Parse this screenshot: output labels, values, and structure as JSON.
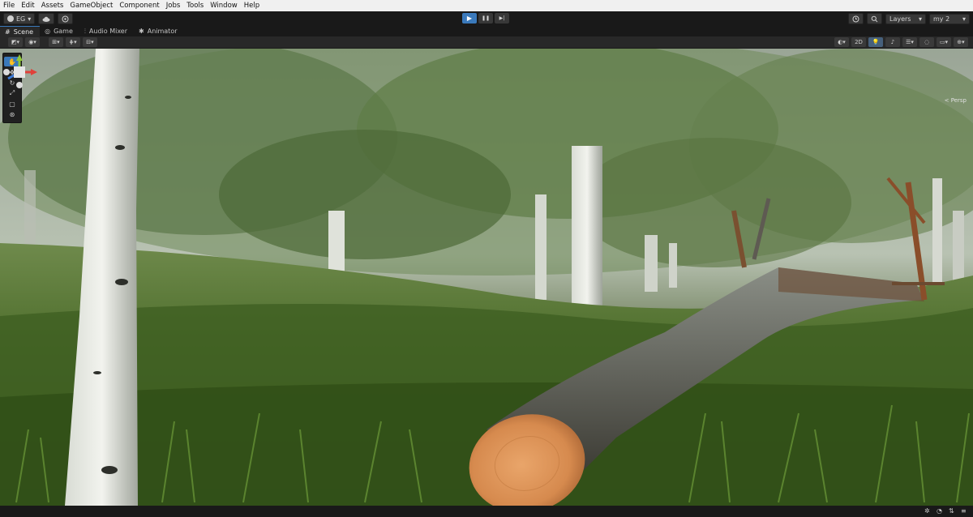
{
  "menu": [
    "File",
    "Edit",
    "Assets",
    "GameObject",
    "Component",
    "Jobs",
    "Tools",
    "Window",
    "Help"
  ],
  "toolbar": {
    "account_label": "EG",
    "cloud_icon": "cloud-icon",
    "collab_icon": "collab-icon",
    "play_icon": "▶",
    "pause_icon": "❚❚",
    "step_icon": "▶|",
    "history_icon": "history-icon",
    "search_icon": "search-icon",
    "layers_label": "Layers",
    "layout_label": "my 2"
  },
  "tabs": [
    {
      "label": "Scene",
      "icon": "grid-icon"
    },
    {
      "label": "Game",
      "icon": "gamepad-icon"
    },
    {
      "label": "Audio Mixer",
      "icon": "mixer-icon"
    },
    {
      "label": "Animator",
      "icon": "animator-icon"
    }
  ],
  "scene_toolbar": {
    "left_icons": [
      "draw-mode-icon",
      "render-icon",
      "pivot-icon",
      "grid-snap-icon",
      "increment-icon"
    ],
    "mode_2d_label": "2D",
    "right_icons": [
      "shading-icon",
      "lighting-icon",
      "audio-icon",
      "effects-icon",
      "hidden-icon",
      "camera-icon",
      "gizmos-icon"
    ]
  },
  "tools": [
    "hand-icon",
    "move-icon",
    "rotate-icon",
    "scale-icon",
    "rect-icon",
    "transform-icon"
  ],
  "gizmo_label": "< Persp",
  "status_icons": [
    "bug-icon",
    "progress-icon",
    "network-icon",
    "layers-icon"
  ]
}
